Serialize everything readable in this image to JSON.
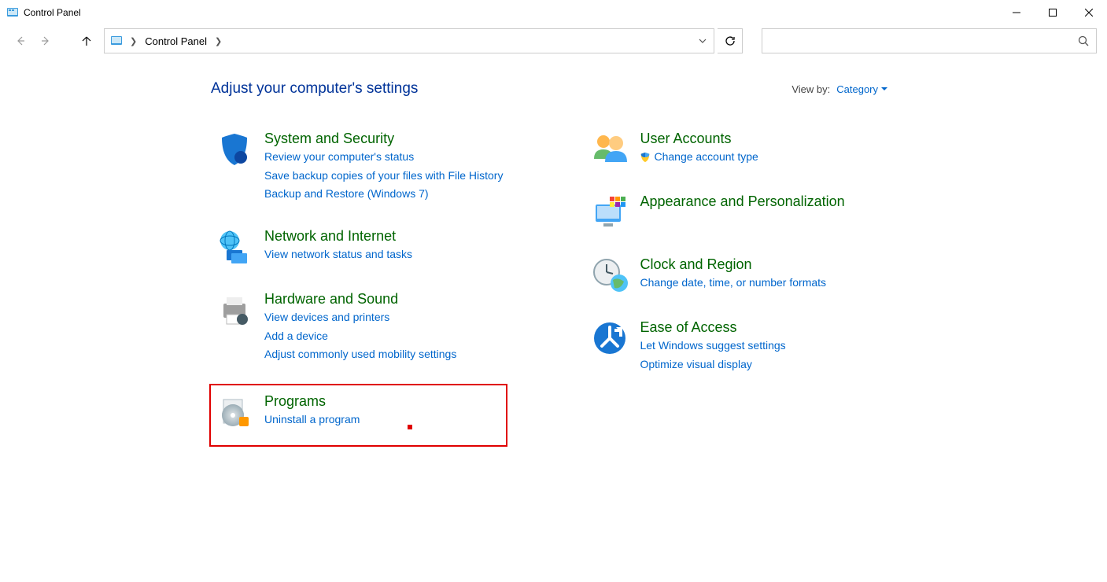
{
  "window": {
    "title": "Control Panel"
  },
  "breadcrumb": {
    "root": "Control Panel"
  },
  "header": {
    "heading": "Adjust your computer's settings",
    "viewby_label": "View by:",
    "viewby_value": "Category"
  },
  "left": [
    {
      "id": "system-security",
      "title": "System and Security",
      "links": [
        "Review your computer's status",
        "Save backup copies of your files with File History",
        "Backup and Restore (Windows 7)"
      ]
    },
    {
      "id": "network-internet",
      "title": "Network and Internet",
      "links": [
        "View network status and tasks"
      ]
    },
    {
      "id": "hardware-sound",
      "title": "Hardware and Sound",
      "links": [
        "View devices and printers",
        "Add a device",
        "Adjust commonly used mobility settings"
      ]
    },
    {
      "id": "programs",
      "title": "Programs",
      "links": [
        "Uninstall a program"
      ],
      "highlighted": true
    }
  ],
  "right": [
    {
      "id": "user-accounts",
      "title": "User Accounts",
      "links": [
        "Change account type"
      ],
      "shield": [
        true
      ]
    },
    {
      "id": "appearance",
      "title": "Appearance and Personalization",
      "links": []
    },
    {
      "id": "clock-region",
      "title": "Clock and Region",
      "links": [
        "Change date, time, or number formats"
      ]
    },
    {
      "id": "ease-access",
      "title": "Ease of Access",
      "links": [
        "Let Windows suggest settings",
        "Optimize visual display"
      ]
    }
  ]
}
